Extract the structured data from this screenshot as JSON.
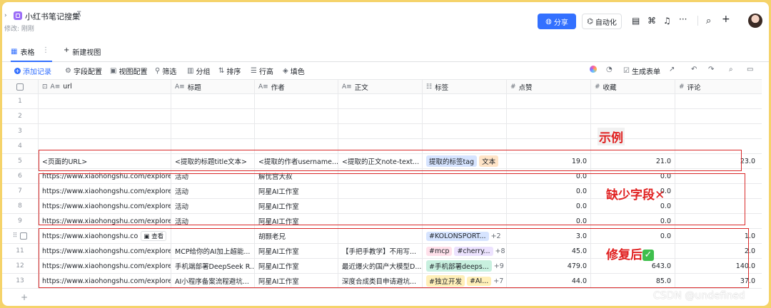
{
  "header": {
    "back": "›",
    "title": "小红书笔记搜集",
    "pin": "⊼",
    "subtitle": "修改: 刚刚",
    "share": "分享",
    "automation": "自动化",
    "more": "···"
  },
  "tabs": {
    "active": "表格",
    "more": "⋮",
    "new_view": "新建视图"
  },
  "toolbar": {
    "add_record": "添加记录",
    "field_config": "字段配置",
    "view_config": "视图配置",
    "filter": "筛选",
    "group": "分组",
    "sort": "排序",
    "row_height": "行高",
    "fill": "填色",
    "generate_form": "生成表单"
  },
  "columns": {
    "url": "url",
    "title": "标题",
    "author": "作者",
    "body": "正文",
    "tags": "标签",
    "likes": "点赞",
    "collects": "收藏",
    "comments": "评论"
  },
  "rows": [
    {
      "n": "1",
      "url": "",
      "title": "",
      "author": "",
      "body": "",
      "tags": [],
      "more": "",
      "likes": "",
      "collects": "",
      "comments": ""
    },
    {
      "n": "2",
      "url": "",
      "title": "",
      "author": "",
      "body": "",
      "tags": [],
      "more": "",
      "likes": "",
      "collects": "",
      "comments": ""
    },
    {
      "n": "3",
      "url": "",
      "title": "",
      "author": "",
      "body": "",
      "tags": [],
      "more": "",
      "likes": "",
      "collects": "",
      "comments": ""
    },
    {
      "n": "4",
      "url": "",
      "title": "",
      "author": "",
      "body": "",
      "tags": [],
      "more": "",
      "likes": "",
      "collects": "",
      "comments": ""
    },
    {
      "n": "5",
      "url": "<页面的URL>",
      "title": "<提取的标题title文本>",
      "author": "<提取的作者username...",
      "body": "<提取的正文note-text...",
      "tags": [
        {
          "t": "提取的标签tag",
          "c": "blue"
        },
        {
          "t": "文本",
          "c": "orange"
        }
      ],
      "more": "",
      "likes": "19.0",
      "collects": "21.0",
      "comments": "23.0"
    },
    {
      "n": "6",
      "url": "https://www.xiaohongshu.com/explore/...",
      "title": "活动",
      "author": "解忧宫大叔",
      "body": "",
      "tags": [],
      "more": "",
      "likes": "0.0",
      "collects": "0.0",
      "comments": ""
    },
    {
      "n": "7",
      "url": "https://www.xiaohongshu.com/explore/...",
      "title": "活动",
      "author": "阿星AI工作室",
      "body": "",
      "tags": [],
      "more": "",
      "likes": "0.0",
      "collects": "0.0",
      "comments": ""
    },
    {
      "n": "8",
      "url": "https://www.xiaohongshu.com/explore/...",
      "title": "活动",
      "author": "阿星AI工作室",
      "body": "",
      "tags": [],
      "more": "",
      "likes": "0.0",
      "collects": "0.0",
      "comments": ""
    },
    {
      "n": "9",
      "url": "https://www.xiaohongshu.com/explore/...",
      "title": "活动",
      "author": "阿星AI工作室",
      "body": "",
      "tags": [],
      "more": "",
      "likes": "0.0",
      "collects": "0.0",
      "comments": ""
    },
    {
      "n": "",
      "url": "https://www.xiaohongshu.co",
      "title": "",
      "author": "胡颢老兄",
      "body": "",
      "tags": [
        {
          "t": "#KOLONSPORT...",
          "c": "blue"
        }
      ],
      "more": "+2",
      "likes": "3.0",
      "collects": "0.0",
      "comments": "1.0",
      "view": "查看"
    },
    {
      "n": "11",
      "url": "https://www.xiaohongshu.com/explore/...",
      "title": "MCP给你的AI加上超能...",
      "author": "阿星AI工作室",
      "body": "【手把手教学】不用写...",
      "tags": [
        {
          "t": "#mcp",
          "c": "pink"
        },
        {
          "t": "#cherry...",
          "c": "purple"
        }
      ],
      "more": "+8",
      "likes": "45.0",
      "collects": "",
      "comments": "2.0"
    },
    {
      "n": "12",
      "url": "https://www.xiaohongshu.com/explore/...",
      "title": "手机端部署DeepSeek R...",
      "author": "阿星AI工作室",
      "body": "最近爆火的国产大模型D...",
      "tags": [
        {
          "t": "#手机部署deeps...",
          "c": "green"
        }
      ],
      "more": "+9",
      "likes": "479.0",
      "collects": "643.0",
      "comments": "140.0"
    },
    {
      "n": "13",
      "url": "https://www.xiaohongshu.com/explore/...",
      "title": "AI小程序备案流程避坑...",
      "author": "阿星AI工作室",
      "body": "深度合成类目申请避坑...",
      "tags": [
        {
          "t": "#独立开发",
          "c": "yellow"
        },
        {
          "t": "#AI...",
          "c": "yellow"
        }
      ],
      "more": "+7",
      "likes": "44.0",
      "collects": "85.0",
      "comments": "37.0"
    }
  ],
  "annotations": {
    "example": "示例",
    "missing": "缺少字段",
    "missing_mark": "✕",
    "fixed": "修复后",
    "fixed_mark": "✓"
  },
  "watermark": "CSDN @undefined",
  "colors": {
    "accent": "#3370ff",
    "annotation_red": "#e02020",
    "frame": "#f5d36a"
  }
}
